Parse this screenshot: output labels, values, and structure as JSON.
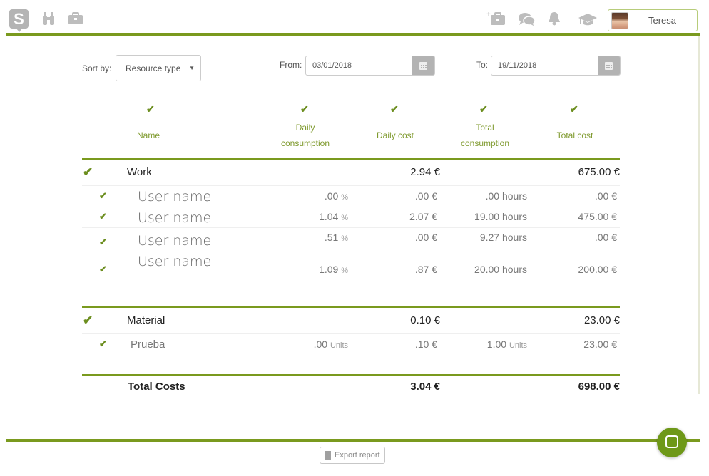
{
  "topbar": {
    "icons_left": [
      "logo-s-icon",
      "binoculars-icon",
      "briefcase-icon"
    ],
    "icons_right": [
      "add-briefcase-icon",
      "chat-bubbles-icon",
      "bell-icon",
      "graduation-cap-icon"
    ],
    "logo_text": "S",
    "user": {
      "name": "Teresa"
    }
  },
  "filters": {
    "sort_label": "Sort by:",
    "sort_value": "Resource type",
    "from_label": "From:",
    "from_value": "03/01/2018",
    "to_label": "To:",
    "to_value": "19/11/2018"
  },
  "table": {
    "check_glyph": "✔",
    "headers": {
      "name": "Name",
      "daily_consumption_1": "Daily",
      "daily_consumption_2": "consumption",
      "daily_cost": "Daily cost",
      "total_consumption_1": "Total",
      "total_consumption_2": "consumption",
      "total_cost": "Total cost"
    },
    "groups": [
      {
        "name": "Work",
        "daily_cost": "2.94 €",
        "total_cost": "675.00 €",
        "rows": [
          {
            "name": "User name",
            "daily_consumption": ".00",
            "daily_unit": "%",
            "daily_cost": ".00 €",
            "total_consumption": ".00 hours",
            "total_cost": ".00 €"
          },
          {
            "name": "User name",
            "daily_consumption": "1.04",
            "daily_unit": "%",
            "daily_cost": "2.07 €",
            "total_consumption": "19.00 hours",
            "total_cost": "475.00 €"
          },
          {
            "name": "User name",
            "daily_consumption": ".51",
            "daily_unit": "%",
            "daily_cost": ".00 €",
            "total_consumption": "9.27 hours",
            "total_cost": ".00 €"
          },
          {
            "name": "User name",
            "daily_consumption": "1.09",
            "daily_unit": "%",
            "daily_cost": ".87 €",
            "total_consumption": "20.00 hours",
            "total_cost": "200.00 €"
          }
        ]
      },
      {
        "name": "Material",
        "daily_cost": "0.10 €",
        "total_cost": "23.00 €",
        "rows": [
          {
            "name": "Prueba",
            "daily_consumption": ".00",
            "daily_unit": "Units",
            "daily_cost": ".10 €",
            "total_consumption": "1.00",
            "total_unit": "Units",
            "total_cost": "23.00 €"
          }
        ]
      }
    ],
    "totals": {
      "label": "Total Costs",
      "daily_cost": "3.04 €",
      "total_cost": "698.00 €"
    }
  },
  "footer": {
    "export_label": "Export report",
    "chat_icon": "chat-icon"
  },
  "colors": {
    "accent": "#7a9a1e",
    "check": "#6c8e1f",
    "header_text": "#7f9a2e"
  }
}
